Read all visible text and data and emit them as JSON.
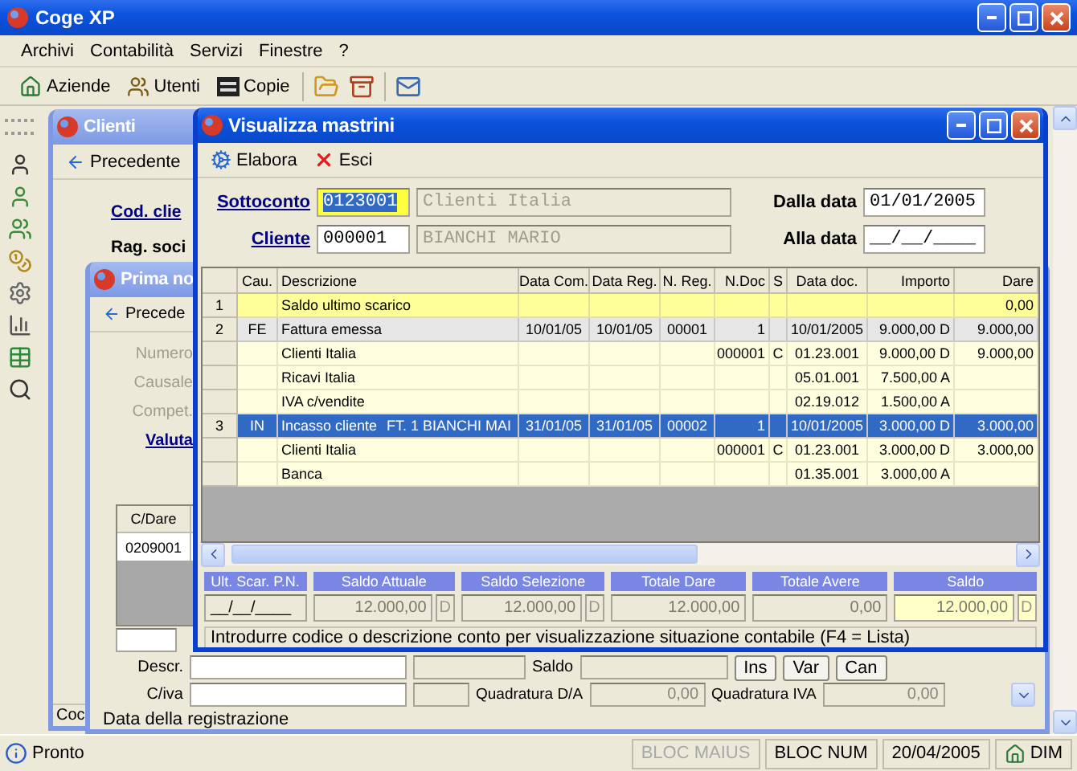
{
  "window": {
    "title": "Coge XP"
  },
  "menu": [
    "Archivi",
    "Contabilità",
    "Servizi",
    "Finestre",
    "?"
  ],
  "toolbar": [
    "Aziende",
    "Utenti",
    "Copie"
  ],
  "clienti": {
    "title": "Clienti",
    "toolbar_button": "Precedente",
    "fields": [
      {
        "label": "Cod. clie",
        "kind": "link"
      },
      {
        "label": "Rag. soci",
        "kind": "plain"
      }
    ],
    "status": "Coc"
  },
  "prima_nota": {
    "title": "Prima no",
    "toolbar_button": "Precede",
    "fields": [
      {
        "label": "Numero",
        "disabled": true
      },
      {
        "label": "Causale",
        "disabled": true
      },
      {
        "label": "Compet.",
        "disabled": true
      },
      {
        "label": "Valuta",
        "disabled": false
      }
    ],
    "grid": {
      "column": "C/Dare",
      "cell": "0209001"
    },
    "descr_label": "Descr.",
    "saldo_label": "Saldo",
    "buttons": [
      "Ins",
      "Var",
      "Can"
    ],
    "civa_label": "C/iva",
    "quadratura_da": {
      "label": "Quadratura D/A",
      "value": "0,00"
    },
    "quadratura_iva": {
      "label": "Quadratura IVA",
      "value": "0,00"
    },
    "status": "Data della registrazione"
  },
  "mastrini": {
    "title": "Visualizza mastrini",
    "toolbar": [
      "Elabora",
      "Esci"
    ],
    "sottoconto": {
      "label": "Sottoconto",
      "code": "0123001",
      "name": "Clienti Italia",
      "focused": true
    },
    "cliente": {
      "label": "Cliente",
      "code": "000001",
      "name": "BIANCHI MARIO",
      "focused": false
    },
    "dalla_data": {
      "label": "Dalla data",
      "value": "01/01/2005"
    },
    "alla_data": {
      "label": "Alla data",
      "value": "__/__/____"
    },
    "table": {
      "columns": [
        "Cau.",
        "Descrizione",
        "Data Com.",
        "Data Reg.",
        "N. Reg.",
        "N.Doc",
        "S",
        "Data doc.",
        "Importo",
        "Dare"
      ],
      "rows": [
        {
          "kind": "opening",
          "selected": false,
          "n": "1",
          "descrizione": "Saldo ultimo scarico",
          "dare": "0,00"
        },
        {
          "kind": "entry",
          "selected": false,
          "n": "2",
          "cau": "FE",
          "descrizione": "Fattura emessa",
          "data_com": "10/01/05",
          "data_reg": "10/01/05",
          "n_reg": "00001",
          "n_doc": "1",
          "data_doc": "10/01/2005",
          "importo": "9.000,00 D",
          "dare": "9.000,00"
        },
        {
          "kind": "line",
          "selected": false,
          "descrizione": "Clienti Italia",
          "n_doc": "000001",
          "s": "C",
          "data_doc": "01.23.001",
          "importo": "9.000,00 D",
          "dare": "9.000,00"
        },
        {
          "kind": "line",
          "selected": false,
          "descrizione": "Ricavi Italia",
          "data_doc": "05.01.001",
          "importo": "7.500,00 A"
        },
        {
          "kind": "line",
          "selected": false,
          "descrizione": "IVA c/vendite",
          "data_doc": "02.19.012",
          "importo": "1.500,00 A"
        },
        {
          "kind": "entry",
          "selected": true,
          "n": "3",
          "cau": "IN",
          "descrizione": "Incasso cliente",
          "nota": "FT. 1 BIANCHI MAI",
          "data_com": "31/01/05",
          "data_reg": "31/01/05",
          "n_reg": "00002",
          "n_doc": "1",
          "data_doc": "10/01/2005",
          "importo": "3.000,00 D",
          "dare": "3.000,00"
        },
        {
          "kind": "line",
          "selected": false,
          "descrizione": "Clienti Italia",
          "n_doc": "000001",
          "s": "C",
          "data_doc": "01.23.001",
          "importo": "3.000,00 D",
          "dare": "3.000,00"
        },
        {
          "kind": "line",
          "selected": false,
          "descrizione": "Banca",
          "data_doc": "01.35.001",
          "importo": "3.000,00 A"
        }
      ]
    },
    "totals": [
      {
        "label": "Ult. Scar. P.N.",
        "value": "__/__/____",
        "highlight": false
      },
      {
        "label": "Saldo Attuale",
        "value": "12.000,00",
        "sign": "D",
        "highlight": false
      },
      {
        "label": "Saldo Selezione",
        "value": "12.000,00",
        "sign": "D",
        "highlight": false
      },
      {
        "label": "Totale Dare",
        "value": "12.000,00",
        "highlight": false
      },
      {
        "label": "Totale Avere",
        "value": "0,00",
        "highlight": false
      },
      {
        "label": "Saldo",
        "value": "12.000,00",
        "sign": "D",
        "highlight": true
      }
    ],
    "status": "Introdurre codice o descrizione conto per visualizzazione situazione contabile (F4 = Lista)"
  },
  "status_bar": {
    "message": "Pronto",
    "indicators": [
      {
        "label": "BLOC MAIUS",
        "disabled": true
      },
      {
        "label": "BLOC NUM",
        "disabled": false
      },
      {
        "label": "20/04/2005",
        "disabled": false
      },
      {
        "label": "DIM",
        "disabled": false
      }
    ]
  }
}
